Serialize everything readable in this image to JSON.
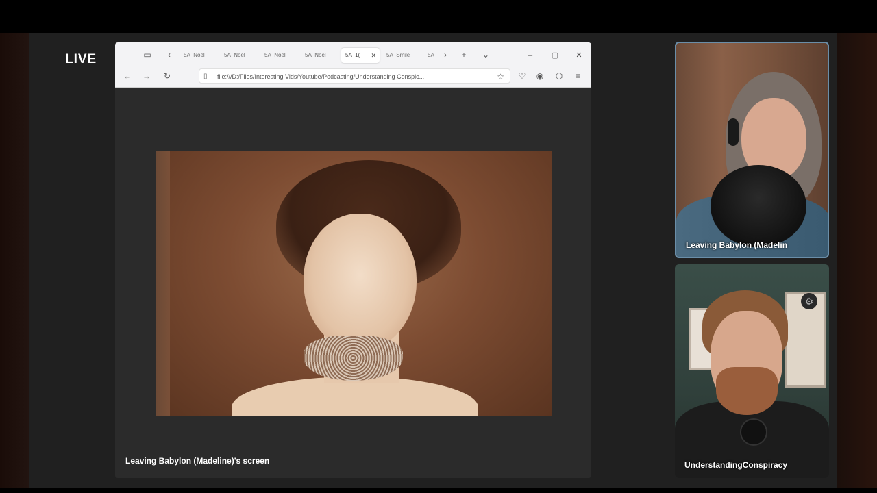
{
  "live_label": "LIVE",
  "browser": {
    "tabs": [
      {
        "label": "5A_Noel"
      },
      {
        "label": "5A_Noel"
      },
      {
        "label": "5A_Noel"
      },
      {
        "label": "5A_Noel"
      },
      {
        "label": "5A_1(",
        "active": true
      },
      {
        "label": "5A_Smile"
      },
      {
        "label": "5A_"
      }
    ],
    "url": "file:///D:/Files/Interesting Vids/Youtube/Podcasting/Understanding Conspic...",
    "icons": {
      "tab_overview": "tab-overview-icon",
      "back_tabs": "chevron-left-icon",
      "fwd_tabs": "chevron-right-icon",
      "new_tab": "plus-icon",
      "tab_list": "chevron-down-icon"
    }
  },
  "screen_caption": "Leaving Babylon (Madeline)'s screen",
  "participants": [
    {
      "name": "Leaving Babylon (Madelin"
    },
    {
      "name": "UnderstandingConspiracy"
    }
  ],
  "colors": {
    "stage_bg": "#202020",
    "active_speaker_border": "#6a8ea8"
  }
}
